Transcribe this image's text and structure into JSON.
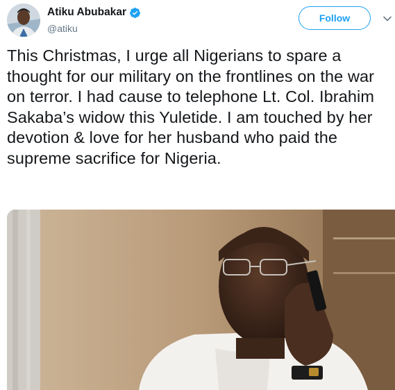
{
  "tweet": {
    "author": {
      "display_name": "Atiku Abubakar",
      "handle": "@atiku",
      "verified": true,
      "avatar_icon": "profile-photo"
    },
    "follow_label": "Follow",
    "menu_icon": "chevron-down-icon",
    "text": "This Christmas, I urge all Nigerians to spare a thought for our military on the frontlines on the war on terror. I had cause to telephone Lt. Col. Ibrahim Sakaba’s widow this Yuletide. I am touched by her devotion & love for her husband who paid the supreme sacrifice for Nigeria.",
    "media": {
      "type": "photo",
      "subject": "man in glasses on a mobile phone call"
    }
  },
  "colors": {
    "accent": "#1da1f2",
    "text": "#14171a",
    "secondary": "#657786"
  }
}
